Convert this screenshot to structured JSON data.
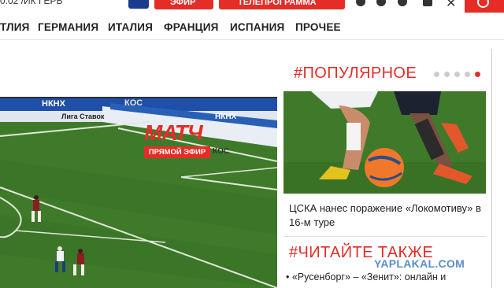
{
  "topbar": {
    "partial_text": "0:02   /ИК ГЕРЬ",
    "btn1_label": "ЭФИР",
    "btn2_label": "ТЕЛЕПРОГРАММА"
  },
  "nav": {
    "items": [
      "ТЛИЯ",
      "ГЕРМАНИЯ",
      "ИТАЛИЯ",
      "ФРАНЦИЯ",
      "ИСПАНИЯ",
      "ПРОЧЕЕ"
    ]
  },
  "video": {
    "logo_text": "МАТЧ",
    "live_badge": "ПРЯМОЙ ЭФИР",
    "ad_banners": [
      "НКНХ",
      "КОС",
      "Лига Ставок",
      "НКНХ",
      "КОС"
    ]
  },
  "sidebar": {
    "popular_title": "#ПОПУЛЯРНОЕ",
    "carousel_active_index": 4,
    "carousel_count": 5,
    "popular_caption": "ЦСКА нанес поражение «Локомотиву» в 16-м туре",
    "read_also_title": "#ЧИТАЙТЕ ТАКЖЕ",
    "read_also_items": [
      "• «Русенборг» – «Зенит»: онлайн и"
    ]
  },
  "watermark": "YAPLAKAL.COM",
  "colors": {
    "accent": "#e52d27",
    "pitch": "#3f7a2a"
  }
}
